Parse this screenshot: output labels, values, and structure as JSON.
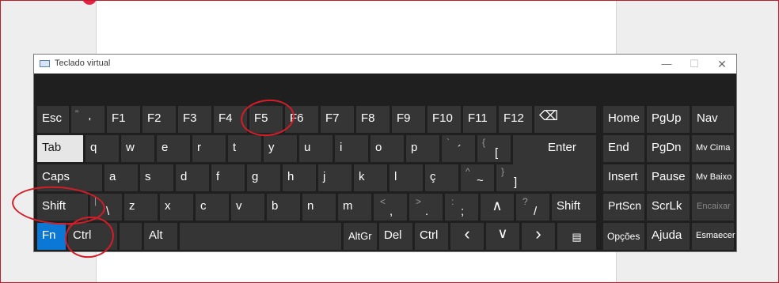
{
  "window": {
    "title": "Teclado virtual",
    "minimize": "—",
    "maximize": "☐",
    "close": "✕"
  },
  "keys": {
    "esc": "Esc",
    "quote_top": "\"",
    "quote_bot": "'",
    "f1": "F1",
    "f2": "F2",
    "f3": "F3",
    "f4": "F4",
    "f5": "F5",
    "f6": "F6",
    "f7": "F7",
    "f8": "F8",
    "f9": "F9",
    "f10": "F10",
    "f11": "F11",
    "f12": "F12",
    "backspace": "⌫",
    "tab": "Tab",
    "q": "q",
    "w": "w",
    "e": "e",
    "r": "r",
    "t": "t",
    "y": "y",
    "u": "u",
    "i": "i",
    "o": "o",
    "p": "p",
    "acute_top": "`",
    "acute_bot": "´",
    "bracket_open_top": "{",
    "bracket_open_bot": "[",
    "enter": "Enter",
    "caps": "Caps",
    "a": "a",
    "s": "s",
    "d": "d",
    "f": "f",
    "g": "g",
    "h": "h",
    "j": "j",
    "k": "k",
    "l": "l",
    "cedilla": "ç",
    "tilde_top": "^",
    "tilde_bot": "~",
    "bracket_close_top": "}",
    "bracket_close_bot": "]",
    "shift_left": "Shift",
    "pipe_top": "|",
    "pipe_bot": "\\",
    "z": "z",
    "x": "x",
    "c": "c",
    "v": "v",
    "b": "b",
    "n": "n",
    "m": "m",
    "lt": "<",
    "comma": ",",
    "gt": ">",
    "period": ".",
    "colon": ":",
    "semicolon": ";",
    "up": "∧",
    "question": "?",
    "slash": "/",
    "shift_right": "Shift",
    "fn": "Fn",
    "ctrl_left": "Ctrl",
    "alt": "Alt",
    "altgr": "AltGr",
    "del": "Del",
    "ctrl_right": "Ctrl",
    "left": "‹",
    "down": "∨",
    "right": "›",
    "menu": "▤",
    "home": "Home",
    "pgup": "PgUp",
    "nav": "Nav",
    "end": "End",
    "pgdn": "PgDn",
    "mv_up": "Mv Cima",
    "insert": "Insert",
    "pause": "Pause",
    "mv_down": "Mv Baixo",
    "prtscn": "PrtScn",
    "scrlk": "ScrLk",
    "dock": "Encaixar",
    "options": "Opções",
    "help": "Ajuda",
    "fade": "Esmaecer"
  }
}
